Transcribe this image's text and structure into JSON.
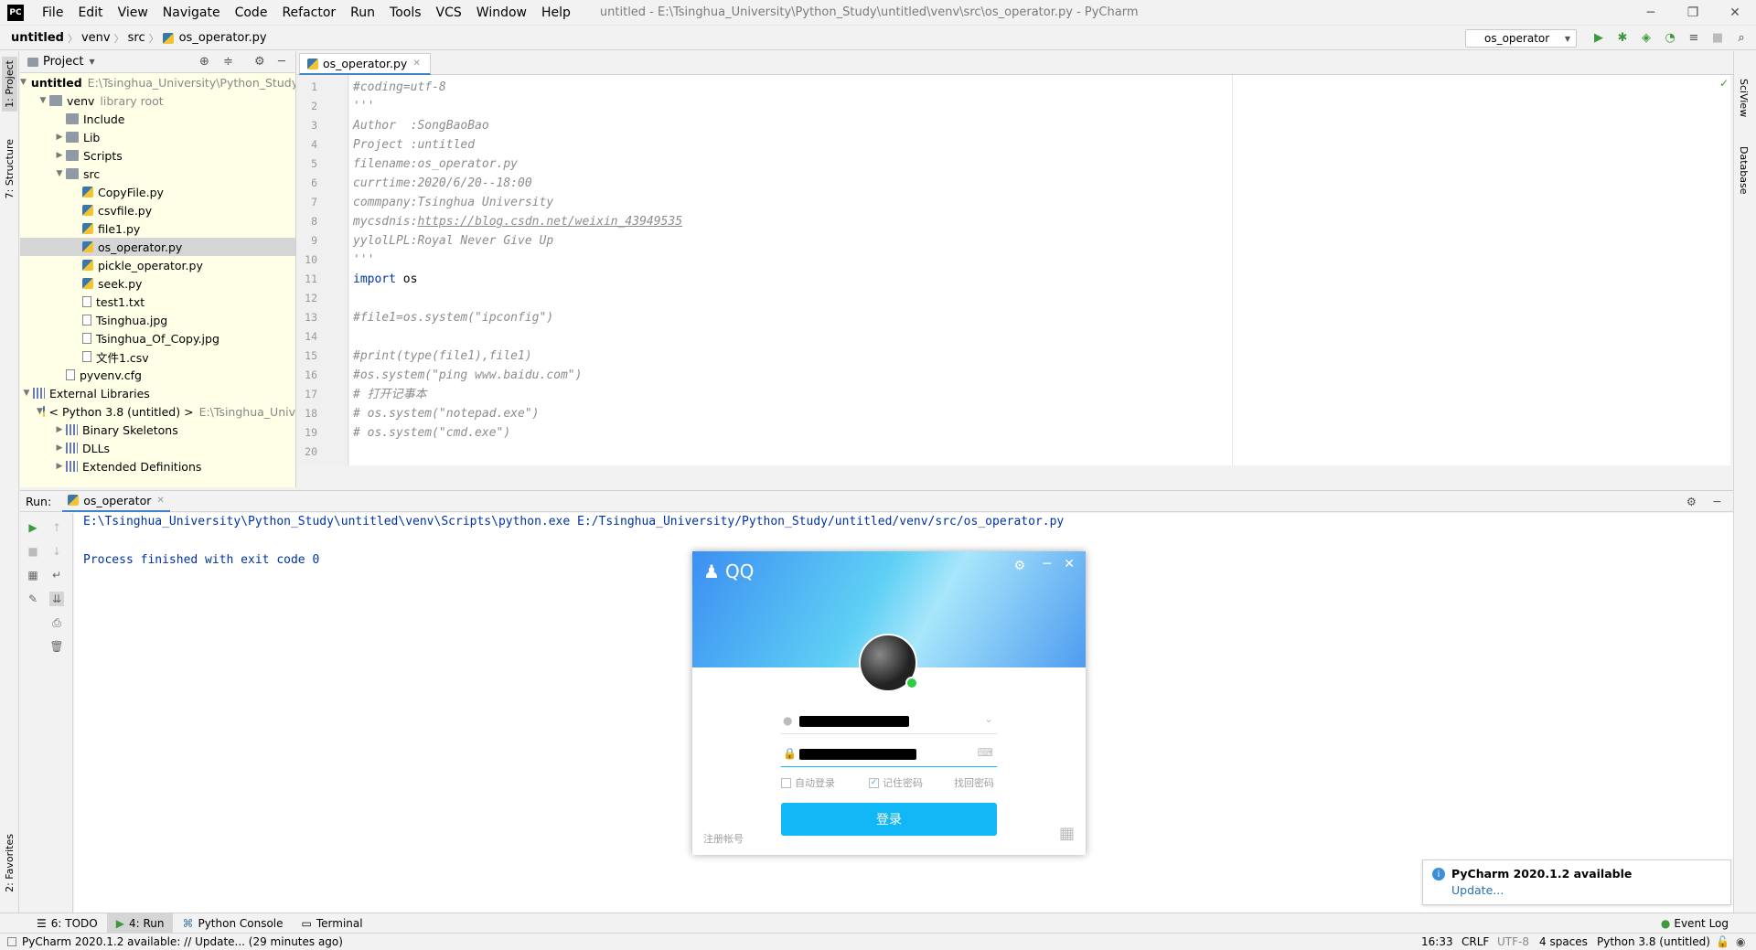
{
  "window": {
    "title": "untitled - E:\\Tsinghua_University\\Python_Study\\untitled\\venv\\src\\os_operator.py - PyCharm",
    "logo": "PC",
    "menu": [
      "File",
      "Edit",
      "View",
      "Navigate",
      "Code",
      "Refactor",
      "Run",
      "Tools",
      "VCS",
      "Window",
      "Help"
    ]
  },
  "breadcrumb": [
    "untitled",
    "venv",
    "src",
    "os_operator.py"
  ],
  "run_config": "os_operator",
  "left_tabs": [
    "1: Project",
    "7: Structure",
    "2: Favorites"
  ],
  "right_tabs": [
    "SciView",
    "Database"
  ],
  "project": {
    "header": "Project",
    "tree": [
      {
        "label": "untitled",
        "hint": "E:\\Tsinghua_University\\Python_Study",
        "bold": true
      },
      {
        "label": "venv",
        "hint": "library root"
      },
      {
        "label": "Include"
      },
      {
        "label": "Lib"
      },
      {
        "label": "Scripts"
      },
      {
        "label": "src"
      },
      {
        "label": "CopyFile.py"
      },
      {
        "label": "csvfile.py"
      },
      {
        "label": "file1.py"
      },
      {
        "label": "os_operator.py"
      },
      {
        "label": "pickle_operator.py"
      },
      {
        "label": "seek.py"
      },
      {
        "label": "test1.txt"
      },
      {
        "label": "Tsinghua.jpg"
      },
      {
        "label": "Tsinghua_Of_Copy.jpg"
      },
      {
        "label": "文件1.csv"
      },
      {
        "label": "pyvenv.cfg"
      },
      {
        "label": "External Libraries"
      },
      {
        "label": "< Python 3.8 (untitled) >",
        "hint": "E:\\Tsinghua_Univ"
      },
      {
        "label": "Binary Skeletons"
      },
      {
        "label": "DLLs"
      },
      {
        "label": "Extended Definitions"
      }
    ]
  },
  "editor": {
    "tab": "os_operator.py",
    "lines": [
      {
        "n": "1",
        "text": "#coding=utf-8",
        "style": "cm"
      },
      {
        "n": "2",
        "text": "'''",
        "style": "cm"
      },
      {
        "n": "3",
        "text": "Author  :SongBaoBao",
        "style": "cm"
      },
      {
        "n": "4",
        "text": "Project :untitled",
        "style": "cm"
      },
      {
        "n": "5",
        "text": "filename:os_operator.py",
        "style": "cm"
      },
      {
        "n": "6",
        "text": "currtime:2020/6/20--18:00",
        "style": "cm"
      },
      {
        "n": "7",
        "text": "commpany:Tsinghua University",
        "style": "cm"
      },
      {
        "n": "8",
        "text": "mycsdnis:",
        "link": "https://blog.csdn.net/weixin_43949535",
        "style": "cm"
      },
      {
        "n": "9",
        "text": "yylolLPL:Royal Never Give Up",
        "style": "cm"
      },
      {
        "n": "10",
        "text": "'''",
        "style": "cm"
      },
      {
        "n": "11",
        "kw": "import",
        "text": " os",
        "style": "code"
      },
      {
        "n": "12",
        "text": "",
        "style": "code"
      },
      {
        "n": "13",
        "text": "#file1=os.system(\"ipconfig\")",
        "style": "cm"
      },
      {
        "n": "14",
        "text": "",
        "style": "code"
      },
      {
        "n": "15",
        "text": "#print(type(file1),file1)",
        "style": "cm"
      },
      {
        "n": "16",
        "text": "#os.system(\"ping www.baidu.com\")",
        "style": "cm"
      },
      {
        "n": "17",
        "text": "# 打开记事本",
        "style": "cm"
      },
      {
        "n": "18",
        "text": "# os.system(\"notepad.exe\")",
        "style": "cm"
      },
      {
        "n": "19",
        "text": "# os.system(\"cmd.exe\")",
        "style": "cm"
      },
      {
        "n": "20",
        "text": "",
        "style": "code"
      }
    ]
  },
  "run": {
    "label": "Run:",
    "tab": "os_operator",
    "console": [
      "E:\\Tsinghua_University\\Python_Study\\untitled\\venv\\Scripts\\python.exe E:/Tsinghua_University/Python_Study/untitled/venv/src/os_operator.py",
      "",
      "Process finished with exit code 0"
    ]
  },
  "qq": {
    "title": "QQ",
    "auto_login": "自动登录",
    "remember_pwd": "记住密码",
    "find_pwd": "找回密码",
    "login": "登录",
    "register": "注册帐号"
  },
  "bottom_tabs": [
    {
      "label": "6: TODO",
      "active": false
    },
    {
      "label": "4: Run",
      "active": true
    },
    {
      "label": "Python Console",
      "active": false
    },
    {
      "label": "Terminal",
      "active": false
    }
  ],
  "event_log": "Event Log",
  "notification": {
    "title": "PyCharm 2020.1.2 available",
    "link": "Update..."
  },
  "status": {
    "message": "PyCharm 2020.1.2 available: // Update... (29 minutes ago)",
    "position": "16:33",
    "line_sep": "CRLF",
    "encoding": "UTF-8",
    "indent": "4 spaces",
    "interpreter": "Python 3.8 (untitled)"
  }
}
